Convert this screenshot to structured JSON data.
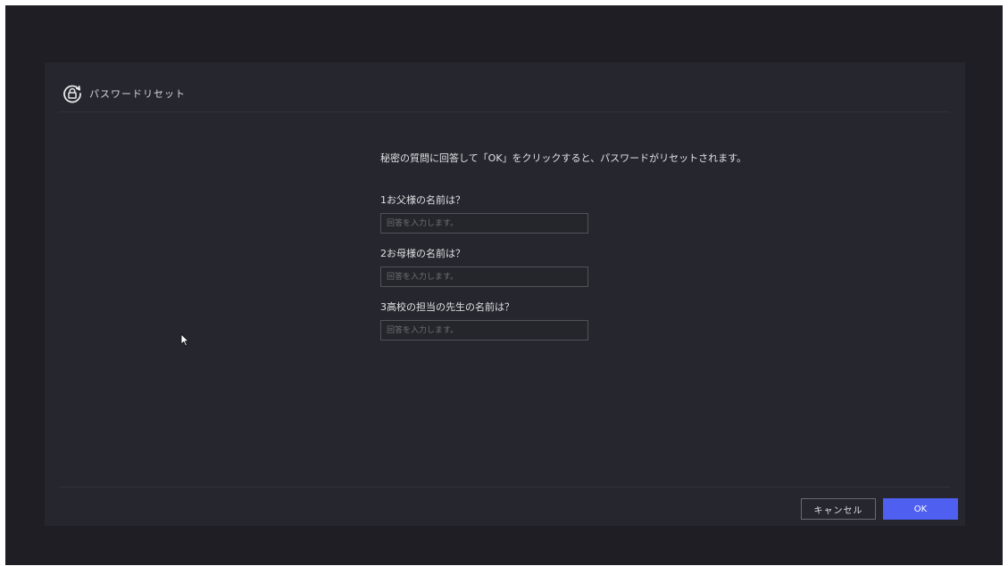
{
  "dialog": {
    "title": "パスワードリセット",
    "icon": "lock-reset-icon"
  },
  "main": {
    "instruction": "秘密の質問に回答して「OK」をクリックすると、パスワードがリセットされます。",
    "questions": [
      {
        "label": "1お父様の名前は？",
        "placeholder": "回答を入力します。",
        "value": ""
      },
      {
        "label": "2お母様の名前は？",
        "placeholder": "回答を入力します。",
        "value": ""
      },
      {
        "label": "3高校の担当の先生の名前は？",
        "placeholder": "回答を入力します。",
        "value": ""
      }
    ]
  },
  "footer": {
    "cancel_label": "キャンセル",
    "ok_label": "OK"
  },
  "colors": {
    "accent": "#4f5ff0",
    "background": "#1e1e24",
    "panel": "#26262e"
  }
}
